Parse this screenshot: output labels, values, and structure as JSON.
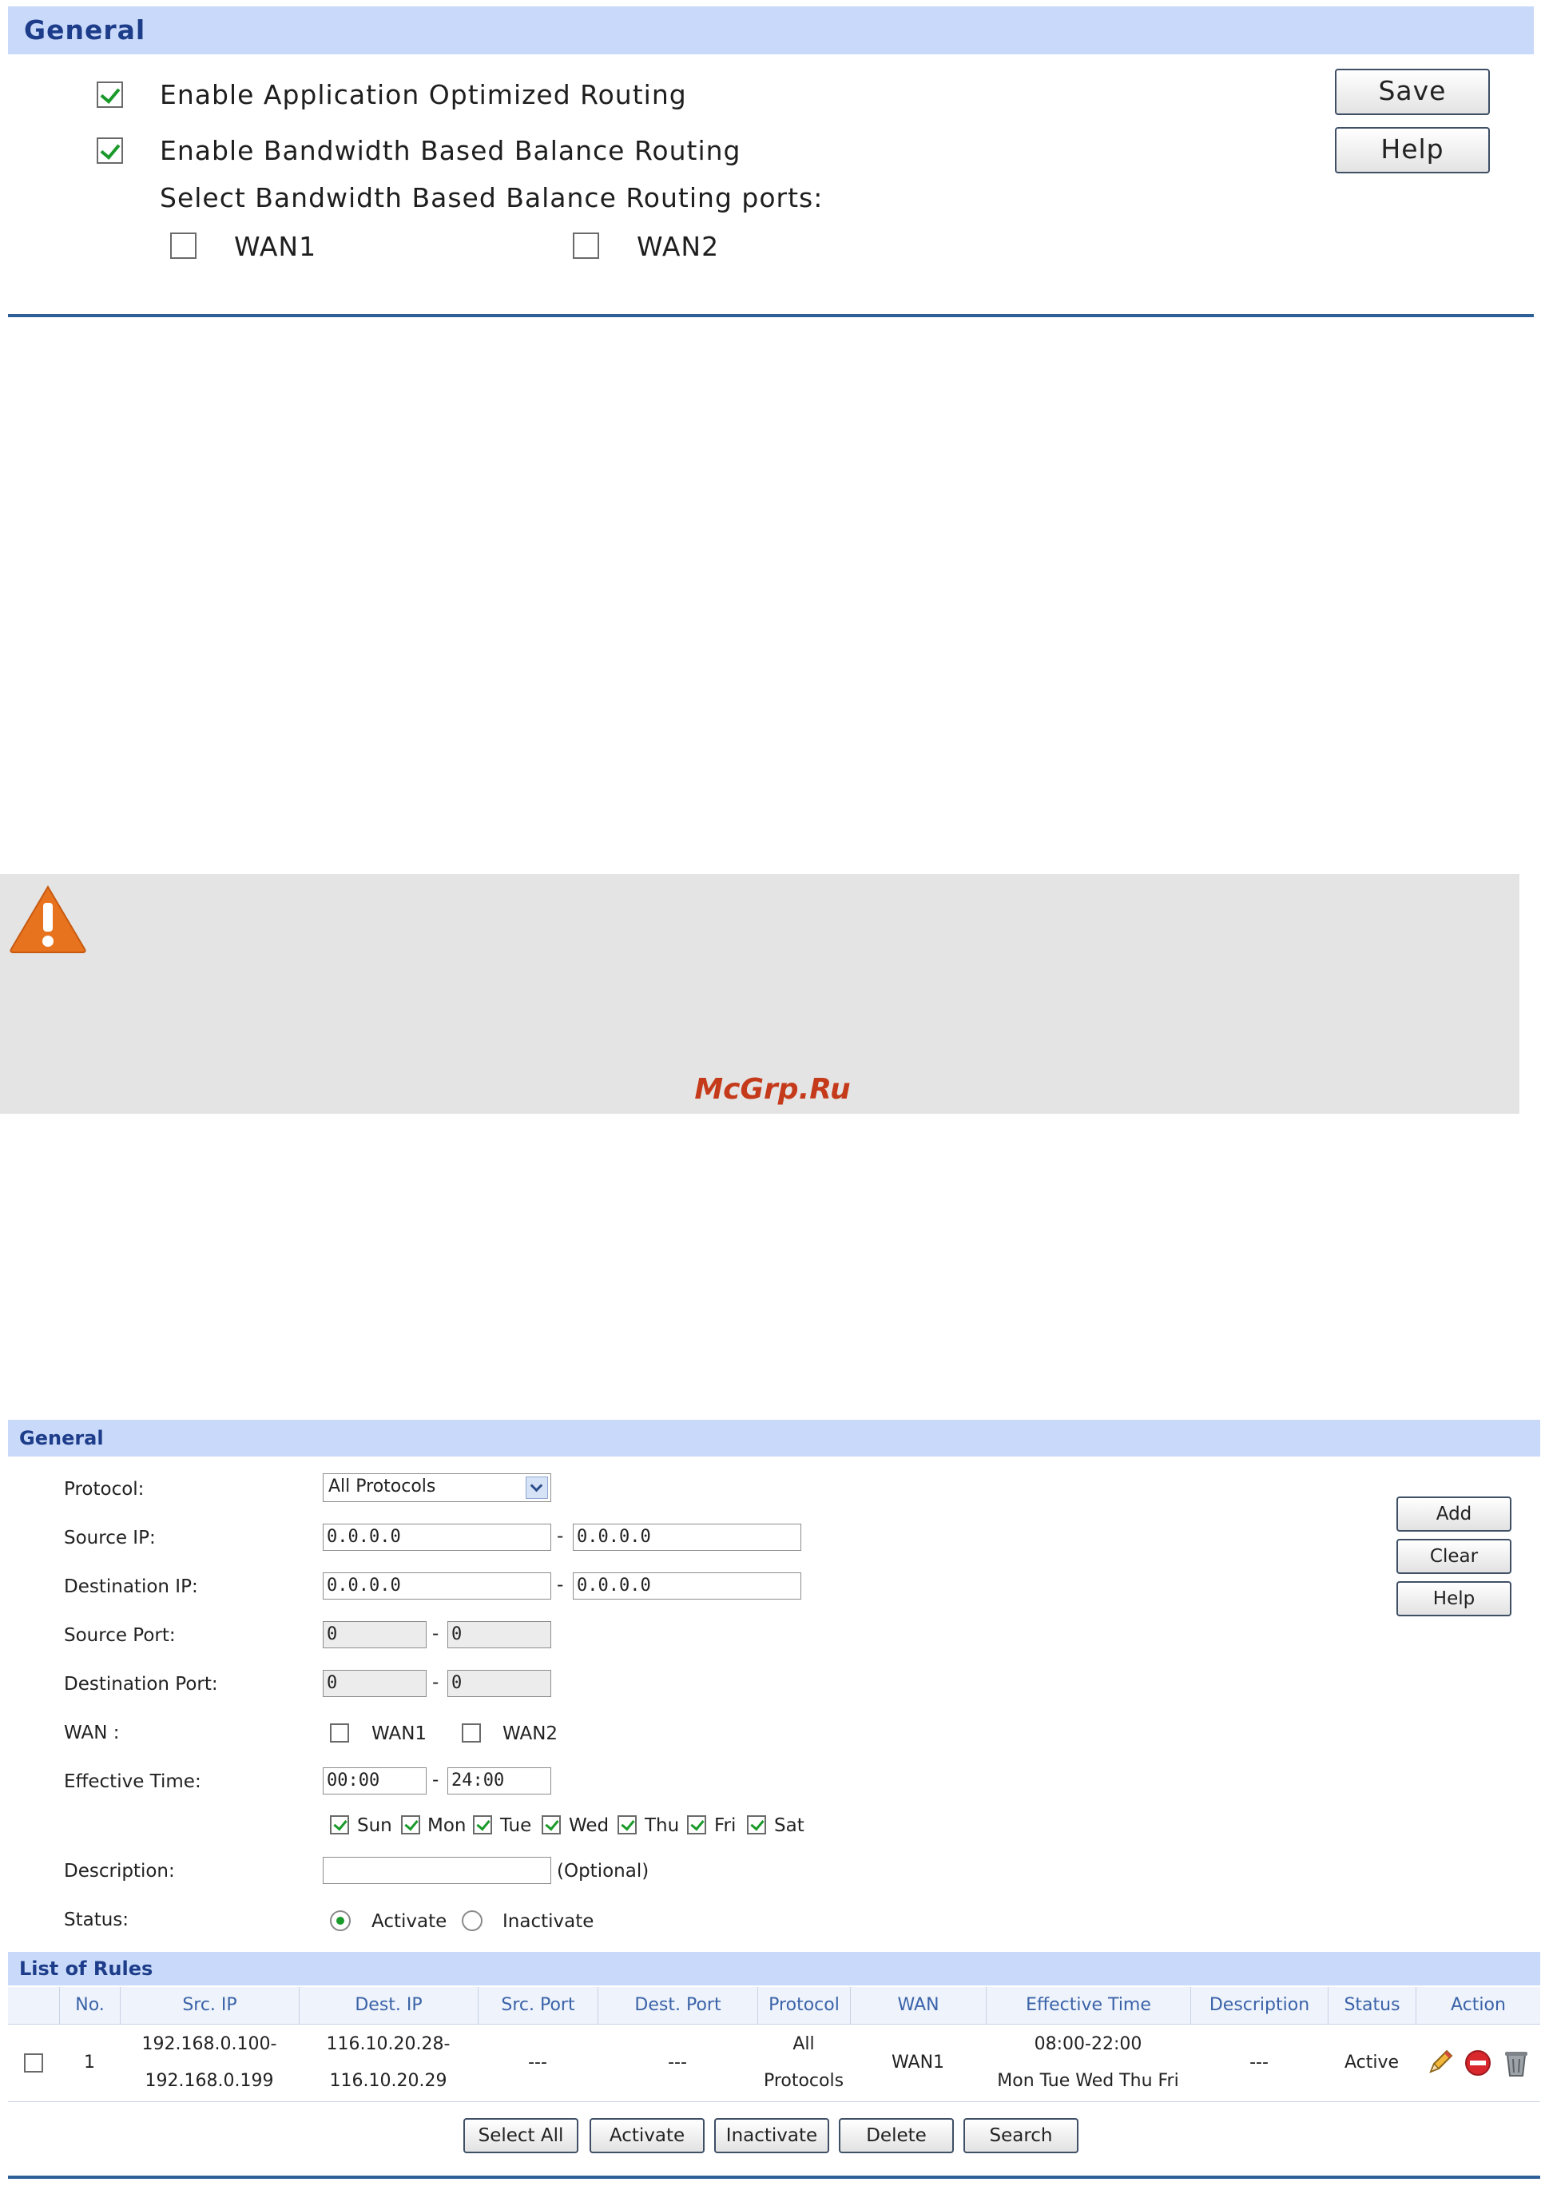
{
  "panel1": {
    "header": "General",
    "enable_app_routing": {
      "label": "Enable Application Optimized Routing",
      "checked": true
    },
    "enable_bandwidth_routing": {
      "label": "Enable Bandwidth Based Balance Routing",
      "checked": true
    },
    "ports_label": "Select Bandwidth Based Balance Routing ports:",
    "ports": [
      {
        "label": "WAN1",
        "checked": false
      },
      {
        "label": "WAN2",
        "checked": false
      }
    ],
    "buttons": {
      "save": "Save",
      "help": "Help"
    }
  },
  "warning": {
    "icon": "warning-triangle-icon",
    "color": "#e8731e"
  },
  "watermark": "McGrp.Ru",
  "panel2": {
    "header": "General",
    "labels": {
      "protocol": "Protocol:",
      "source_ip": "Source IP:",
      "destination_ip": "Destination IP:",
      "source_port": "Source Port:",
      "destination_port": "Destination Port:",
      "wan": "WAN :",
      "effective_time": "Effective Time:",
      "description": "Description:",
      "status": "Status:"
    },
    "protocol_value": "All Protocols",
    "source_ip_from": "0.0.0.0",
    "source_ip_to": "0.0.0.0",
    "destination_ip_from": "0.0.0.0",
    "destination_ip_to": "0.0.0.0",
    "source_port_from": "0",
    "source_port_to": "0",
    "destination_port_from": "0",
    "destination_port_to": "0",
    "wan_options": [
      {
        "label": "WAN1",
        "checked": false
      },
      {
        "label": "WAN2",
        "checked": false
      }
    ],
    "time_from": "00:00",
    "time_to": "24:00",
    "days": [
      {
        "label": "Sun",
        "checked": true
      },
      {
        "label": "Mon",
        "checked": true
      },
      {
        "label": "Tue",
        "checked": true
      },
      {
        "label": "Wed",
        "checked": true
      },
      {
        "label": "Thu",
        "checked": true
      },
      {
        "label": "Fri",
        "checked": true
      },
      {
        "label": "Sat",
        "checked": true
      }
    ],
    "dash": "-",
    "description_value": "",
    "optional_hint": "(Optional)",
    "status_options": {
      "activate": "Activate",
      "inactivate": "Inactivate",
      "selected": "Activate"
    },
    "buttons": {
      "add": "Add",
      "clear": "Clear",
      "help": "Help"
    }
  },
  "rules": {
    "header": "List of Rules",
    "columns": [
      "No.",
      "Src. IP",
      "Dest. IP",
      "Src. Port",
      "Dest. Port",
      "Protocol",
      "WAN",
      "Effective Time",
      "Description",
      "Status",
      "Action"
    ],
    "rows": [
      {
        "no": "1",
        "src_ip": [
          "192.168.0.100-",
          "192.168.0.199"
        ],
        "dest_ip": [
          "116.10.20.28-",
          "116.10.20.29"
        ],
        "src_port": "---",
        "dest_port": "---",
        "protocol": [
          "All",
          "Protocols"
        ],
        "wan": "WAN1",
        "effective_time": [
          "08:00-22:00",
          "Mon Tue Wed Thu Fri"
        ],
        "description": "---",
        "status": "Active",
        "actions": [
          "edit-icon",
          "disable-icon",
          "delete-icon"
        ]
      }
    ],
    "buttons": {
      "select_all": "Select All",
      "activate": "Activate",
      "inactivate": "Inactivate",
      "delete": "Delete",
      "search": "Search"
    }
  }
}
